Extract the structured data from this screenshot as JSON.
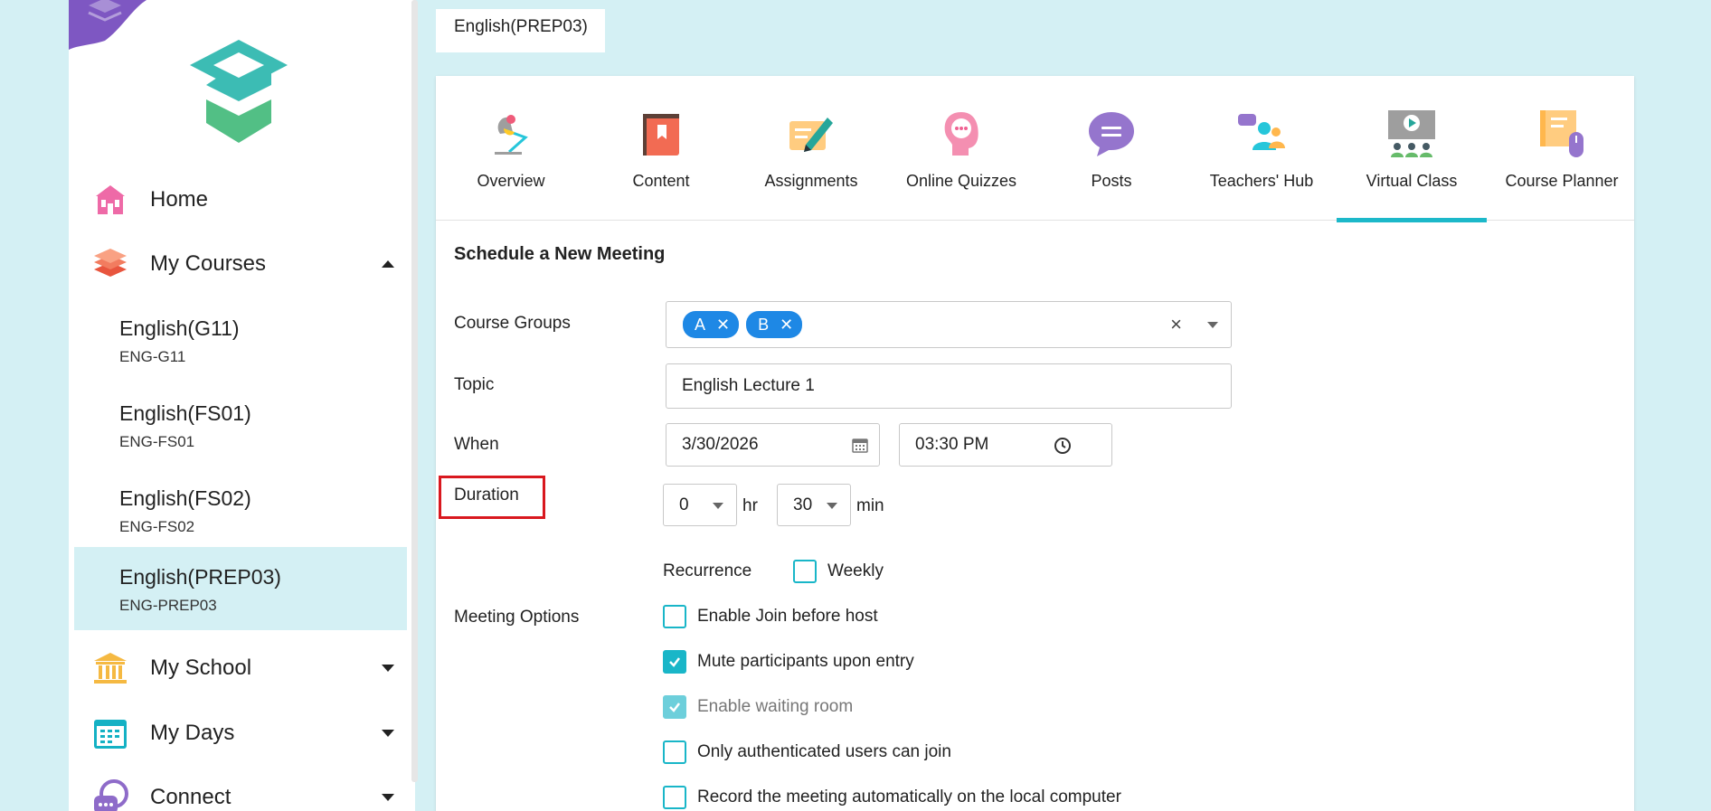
{
  "sidebar": {
    "nav": [
      {
        "label": "Home",
        "icon": "home-icon"
      },
      {
        "label": "My Courses",
        "icon": "books-icon"
      },
      {
        "label": "My School",
        "icon": "school-building-icon"
      },
      {
        "label": "My Days",
        "icon": "calendar-icon"
      },
      {
        "label": "Connect",
        "icon": "chat-icon"
      }
    ],
    "courses": [
      {
        "name": "English(G11)",
        "code": "ENG-G11"
      },
      {
        "name": "English(FS01)",
        "code": "ENG-FS01"
      },
      {
        "name": "English(FS02)",
        "code": "ENG-FS02"
      },
      {
        "name": "English(PREP03)",
        "code": "ENG-PREP03"
      }
    ]
  },
  "header": {
    "course_tab": "English(PREP03)"
  },
  "tabs": [
    {
      "label": "Overview",
      "icon": "desk-lamp-icon"
    },
    {
      "label": "Content",
      "icon": "book-icon"
    },
    {
      "label": "Assignments",
      "icon": "pen-paper-icon"
    },
    {
      "label": "Online Quizzes",
      "icon": "head-chat-icon"
    },
    {
      "label": "Posts",
      "icon": "speech-bubble-icon"
    },
    {
      "label": "Teachers' Hub",
      "icon": "teachers-group-icon"
    },
    {
      "label": "Virtual Class",
      "icon": "presentation-screen-icon"
    },
    {
      "label": "Course Planner",
      "icon": "planner-icon"
    }
  ],
  "active_tab": "Virtual Class",
  "form": {
    "title": "Schedule a New Meeting",
    "course_groups_label": "Course Groups",
    "chips": [
      "A",
      "B"
    ],
    "topic_label": "Topic",
    "topic_value": "English Lecture 1",
    "when_label": "When",
    "date_value": "3/30/2026",
    "time_value": "03:30 PM",
    "duration_label": "Duration",
    "duration_hr": "0",
    "hr_suffix": "hr",
    "duration_min": "30",
    "min_suffix": "min",
    "recurrence_label": "Recurrence",
    "weekly_label": "Weekly",
    "meeting_options_label": "Meeting Options",
    "options": [
      {
        "label": "Enable Join before host",
        "state": "unchecked"
      },
      {
        "label": "Mute participants upon entry",
        "state": "checked"
      },
      {
        "label": "Enable waiting room",
        "state": "disabled-checked"
      },
      {
        "label": "Only authenticated users can join",
        "state": "unchecked"
      },
      {
        "label": "Record the meeting automatically on the local computer",
        "state": "unchecked"
      }
    ]
  },
  "colors": {
    "accent": "#1cb8c9",
    "chip": "#1e88e5",
    "highlight": "#d9181f",
    "background": "#d4f0f4"
  }
}
